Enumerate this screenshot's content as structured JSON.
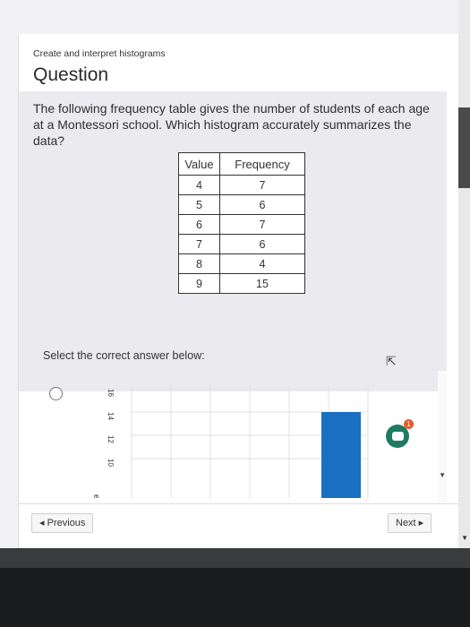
{
  "breadcrumb": "Create and interpret histograms",
  "title": "Question",
  "question_text": "The following frequency table gives the number of students of each age at a Montessori school. Which histogram accurately summarizes the data?",
  "table": {
    "headers": [
      "Value",
      "Frequency"
    ],
    "rows": [
      {
        "value": "4",
        "frequency": "7"
      },
      {
        "value": "5",
        "frequency": "6"
      },
      {
        "value": "6",
        "frequency": "7"
      },
      {
        "value": "7",
        "frequency": "6"
      },
      {
        "value": "8",
        "frequency": "4"
      },
      {
        "value": "9",
        "frequency": "15"
      }
    ]
  },
  "prompt": "Select the correct answer below:",
  "chart_data": {
    "type": "bar",
    "ylabel": "ency",
    "y_ticks": [
      "16",
      "14",
      "12",
      "10"
    ],
    "visible_bar_top": 14,
    "bar_color": "#1b6fc2"
  },
  "chat_badge": "1",
  "nav": {
    "previous": "◂ Previous",
    "next": "Next ▸"
  },
  "colors": {
    "bar": "#1b6fc2",
    "chat": "#1f7a63",
    "badge": "#e65a2b"
  }
}
